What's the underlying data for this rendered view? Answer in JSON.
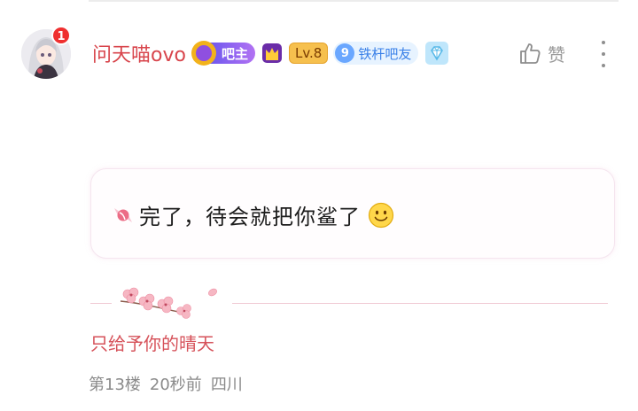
{
  "post": {
    "user": {
      "name": "问天喵ovo",
      "notification_count": "1",
      "bazhu_label": "吧主",
      "level": "Lv.8",
      "fan_level": "9",
      "fan_title": "铁杆吧友"
    },
    "like_label": "赞",
    "message": "完了，待会就把你鲨了",
    "signature": "只给予你的晴天",
    "meta": {
      "floor": "第13楼",
      "time": "20秒前",
      "location": "四川"
    }
  },
  "icons": [
    "crown-icon",
    "diamond-icon",
    "thumbs-up-icon",
    "more-vertical-icon",
    "candy-icon",
    "smile-emoji-icon",
    "cherry-blossom-decoration"
  ],
  "colors": {
    "username": "#d8454c",
    "notification": "#ef2f2f",
    "bazhu_gradient": [
      "#6d57ee",
      "#b272f3"
    ],
    "level_badge": "#f6c04e",
    "fan_badge": "#e7f3ff",
    "signature": "#d6525a",
    "meta_text": "#8a8a8a"
  }
}
